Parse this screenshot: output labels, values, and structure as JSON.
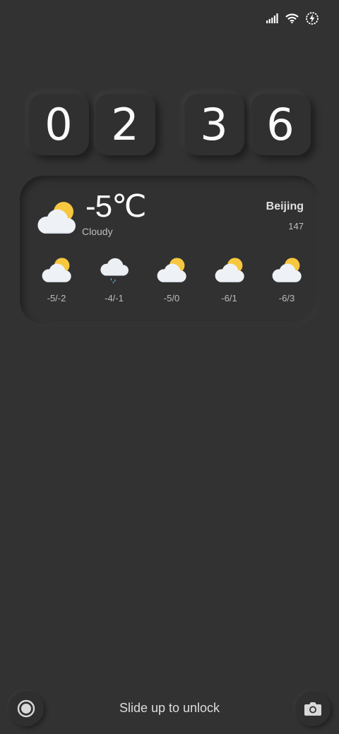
{
  "status_bar": {
    "icons": [
      "signal-icon",
      "wifi-icon",
      "battery-charging-icon"
    ]
  },
  "clock": {
    "digits": [
      "0",
      "2",
      "3",
      "6"
    ]
  },
  "weather": {
    "current": {
      "temperature": "-5℃",
      "condition": "Cloudy",
      "icon": "partly-cloudy-icon"
    },
    "city": "Beijing",
    "aqi": "147",
    "forecast": [
      {
        "range": "-5/-2",
        "icon": "partly-cloudy-icon"
      },
      {
        "range": "-4/-1",
        "icon": "rain-cloud-icon"
      },
      {
        "range": "-5/0",
        "icon": "partly-cloudy-icon"
      },
      {
        "range": "-6/1",
        "icon": "partly-cloudy-icon"
      },
      {
        "range": "-6/3",
        "icon": "partly-cloudy-icon"
      }
    ]
  },
  "bottom": {
    "unlock_hint": "Slide up to unlock",
    "left_icon": "target-icon",
    "right_icon": "camera-icon"
  },
  "colors": {
    "background": "#323232",
    "sun": "#f7c740",
    "cloud": "#eef2f7",
    "rain": "#4fc3f7"
  }
}
